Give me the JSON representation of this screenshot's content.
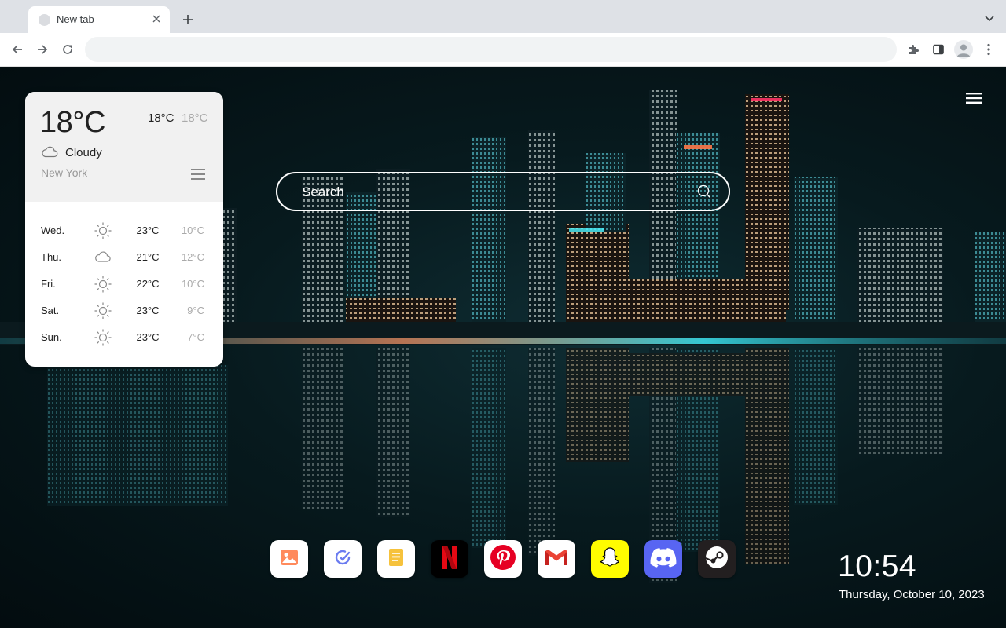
{
  "browser": {
    "tab_title": "New tab",
    "omnibox_value": ""
  },
  "weather": {
    "current_temp": "18°C",
    "high": "18°C",
    "low": "18°C",
    "condition": "Cloudy",
    "condition_icon": "cloud-icon",
    "city": "New York",
    "forecast": [
      {
        "day": "Wed.",
        "icon": "sun-icon",
        "high": "23°C",
        "low": "10°C"
      },
      {
        "day": "Thu.",
        "icon": "cloud-icon",
        "high": "21°C",
        "low": "12°C"
      },
      {
        "day": "Fri.",
        "icon": "sun-icon",
        "high": "22°C",
        "low": "10°C"
      },
      {
        "day": "Sat.",
        "icon": "sun-icon",
        "high": "23°C",
        "low": "9°C"
      },
      {
        "day": "Sun.",
        "icon": "sun-icon",
        "high": "23°C",
        "low": "7°C"
      }
    ]
  },
  "search": {
    "placeholder": "Search"
  },
  "apps": [
    {
      "name": "photos",
      "icon": "photos-icon",
      "bg": "#ffffff"
    },
    {
      "name": "tasks",
      "icon": "tasks-icon",
      "bg": "#ffffff"
    },
    {
      "name": "notes",
      "icon": "notes-icon",
      "bg": "#ffffff"
    },
    {
      "name": "netflix",
      "icon": "netflix-icon",
      "bg": "#000000"
    },
    {
      "name": "pinterest",
      "icon": "pinterest-icon",
      "bg": "#ffffff"
    },
    {
      "name": "gmail",
      "icon": "gmail-icon",
      "bg": "#ffffff"
    },
    {
      "name": "snapchat",
      "icon": "snapchat-icon",
      "bg": "#fffc00"
    },
    {
      "name": "discord",
      "icon": "discord-icon",
      "bg": "#5865f2"
    },
    {
      "name": "steam",
      "icon": "steam-icon",
      "bg": "#231f20"
    }
  ],
  "clock": {
    "time": "10:54",
    "date": "Thursday, October 10, 2023"
  },
  "colors": {
    "accent_teal": "#2ee6e6",
    "accent_pink": "#ff3366",
    "netflix_red": "#e50914",
    "pinterest_red": "#e60023",
    "discord_blurple": "#5865f2",
    "snapchat_yellow": "#fffc00"
  }
}
